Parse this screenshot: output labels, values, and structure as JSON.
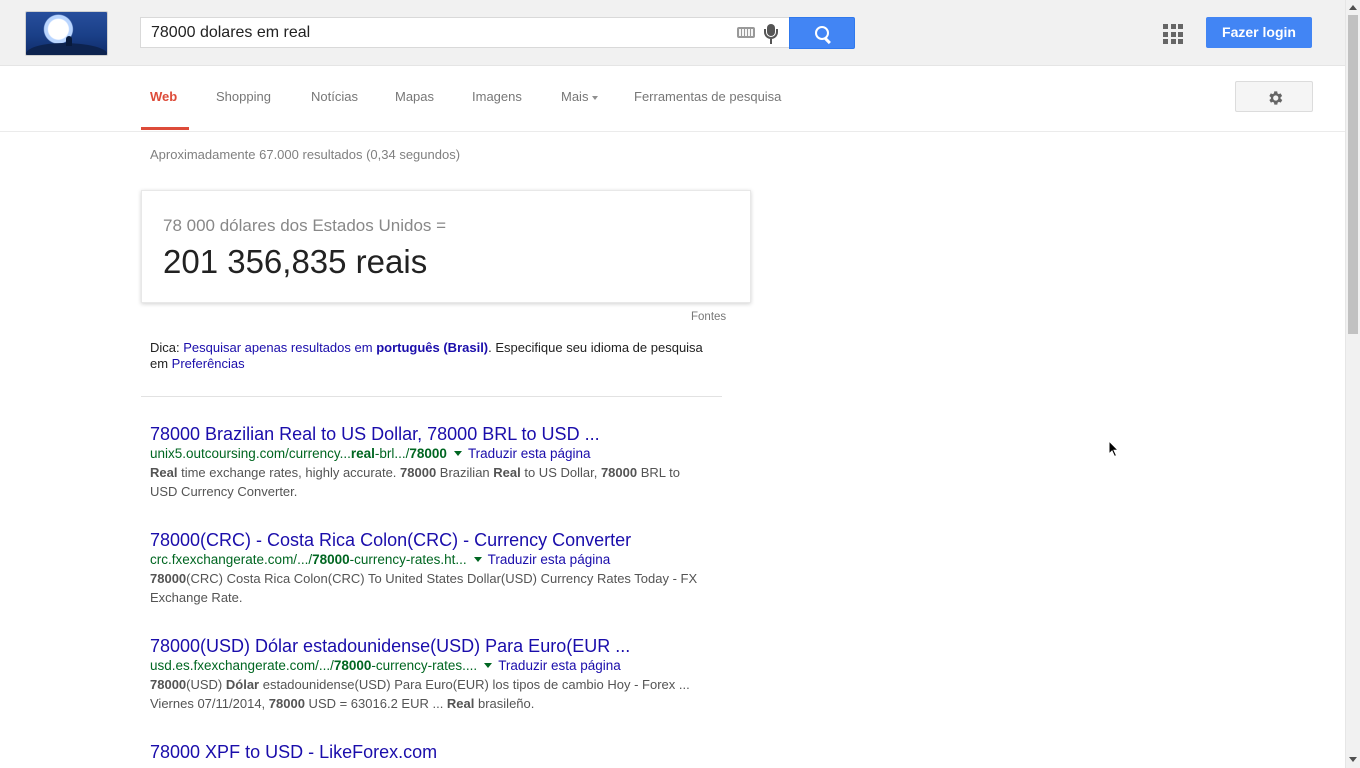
{
  "search": {
    "query": "78000 dolares em real"
  },
  "header": {
    "login_label": "Fazer login"
  },
  "nav": {
    "tabs": [
      "Web",
      "Shopping",
      "Notícias",
      "Mapas",
      "Imagens",
      "Mais",
      "Ferramentas de pesquisa"
    ]
  },
  "stats": "Aproximadamente 67.000 resultados (0,34 segundos)",
  "converter": {
    "from": "78 000 dólares dos Estados Unidos =",
    "to": "201 356,835 reais",
    "sources": "Fontes"
  },
  "hint": {
    "prefix": "Dica: ",
    "link_text": "Pesquisar apenas resultados em ",
    "language": "português (Brasil)",
    "middle": ". Especifique seu idioma de pesquisa em ",
    "prefs": "Preferências"
  },
  "results": [
    {
      "title": "78000 Brazilian Real to US Dollar, 78000 BRL to USD ...",
      "url_parts": [
        "unix5.outcoursing.com/currency...",
        "real",
        "-brl.../",
        "78000"
      ],
      "translate": "Traduzir esta página",
      "snippet_parts": [
        "Real",
        " time exchange rates, highly accurate. ",
        "78000",
        " Brazilian ",
        "Real",
        " to US Dollar, ",
        "78000",
        " BRL to USD Currency Converter."
      ]
    },
    {
      "title": "78000(CRC) - Costa Rica Colon(CRC) - Currency Converter",
      "url_parts": [
        "crc.fxexchangerate.com/.../",
        "78000",
        "-currency-rates.ht..."
      ],
      "translate": "Traduzir esta página",
      "snippet_parts": [
        "78000",
        "(CRC) Costa Rica Colon(CRC) To United States Dollar(USD) Currency Rates Today - FX Exchange Rate."
      ]
    },
    {
      "title": "78000(USD) Dólar estadounidense(USD) Para Euro(EUR ...",
      "url_parts": [
        "usd.es.fxexchangerate.com/.../",
        "78000",
        "-currency-rates...."
      ],
      "translate": "Traduzir esta página",
      "snippet_parts": [
        "78000",
        "(USD) ",
        "Dólar",
        " estadounidense(USD) Para Euro(EUR) los tipos de cambio Hoy - Forex ... Viernes 07/11/2014, ",
        "78000",
        " USD = 63016.2 EUR ... ",
        "Real",
        " brasileño."
      ]
    },
    {
      "title": "78000 XPF to USD - LikeForex.com"
    }
  ]
}
